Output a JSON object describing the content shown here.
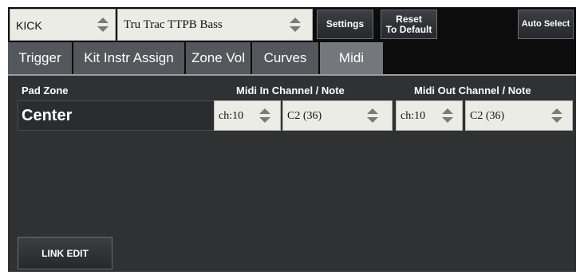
{
  "topbar": {
    "kit_select": "KICK",
    "instrument_select": "Tru Trac TTPB Bass",
    "settings_label": "Settings",
    "reset_line1": "Reset",
    "reset_line2": "To Default",
    "auto_select_label": "Auto Select"
  },
  "tabs": [
    {
      "label": "Trigger",
      "active": false
    },
    {
      "label": "Kit Instr Assign",
      "active": false
    },
    {
      "label": "Zone Vol",
      "active": false
    },
    {
      "label": "Curves",
      "active": false
    },
    {
      "label": "Midi",
      "active": true
    }
  ],
  "columns": {
    "pad_zone": "Pad Zone",
    "midi_in": "Midi In Channel / Note",
    "midi_out": "Midi Out Channel / Note"
  },
  "row": {
    "zone": "Center",
    "in_channel": "ch:10",
    "in_note": "C2 (36)",
    "out_channel": "ch:10",
    "out_note": "C2 (36)"
  },
  "footer": {
    "link_edit_label": "LINK EDIT"
  },
  "icons": {
    "spinner": "up-down-spinner-icon"
  },
  "colors": {
    "background": "#2f3133",
    "bar": "#0c0c0c",
    "tab": "#54575b",
    "tab_active": "#74777c",
    "field": "#ecece6"
  }
}
